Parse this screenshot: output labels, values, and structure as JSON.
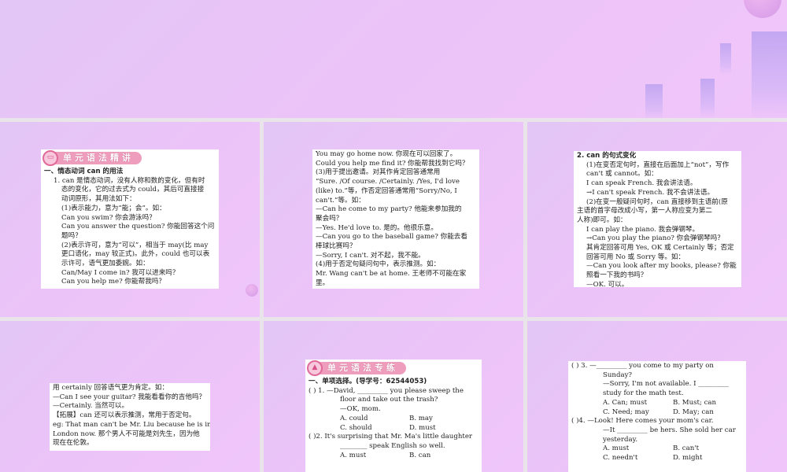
{
  "slides": [
    {
      "header": "单元语法精讲",
      "lines": [
        "一、情态动词 can 的用法",
        "1. can 是情态动词，没有人称和数的变化，但有时",
        "态的变化，它的过去式为 could，其后可直接接",
        "动词原形，其用法如下：",
        "(1)表示能力，意为“能；会”。如：",
        "Can you swim? 你会游泳吗？",
        "Can you answer the question? 你能回答这个问",
        "题吗？",
        "(2)表示许可，意为“可以”，相当于 may(比 may",
        "更口语化，may 较正式)。此外，could 也可以表",
        "示许可，语气更加委婉。如：",
        "Can/May I come in? 我可以进来吗？",
        "Can you help me? 你能帮我吗？"
      ]
    },
    {
      "lines": [
        "You may go home now. 你现在可以回家了。",
        "Could you help me find it? 你能帮我找到它吗？",
        "(3)用于提出邀请。对其作肯定回答通常用",
        "“Sure. /Of course. /Certainly. /Yes, I'd love",
        "(like) to.”等，作否定回答通常用“Sorry/No, I",
        "can't.”等。如：",
        "—Can he come to my party? 他能来参加我的",
        "聚会吗？",
        "—Yes. He'd love to. 是的。他很乐意。",
        "—Can you go to the baseball game? 你能去看",
        "棒球比赛吗？",
        "—Sorry, I can't. 对不起，我不能。",
        "(4)用于否定句疑问句中，表示推测。如：",
        "Mr. Wang can't be at home. 王老师不可能在家",
        "里。"
      ]
    },
    {
      "lines": [
        "2. can 的句式变化",
        "(1)在变否定句时，直接在后面加上“not”，写作",
        "can't 或 cannot。如：",
        "I can speak French. 我会讲法语。",
        "→I can't speak French. 我不会讲法语。",
        "(2)在变一般疑问句时，can 直接移到主语前(原",
        "主语的首字母改成小写，第一人称应变为第二",
        "人称)即可。如：",
        "I can play the piano. 我会弹钢琴。",
        "→Can you play the piano? 你会弹钢琴吗？",
        "其肯定回答可用 Yes, OK 或 Certainly 等；否定",
        "回答可用 No 或 Sorry 等。如：",
        "—Can you look after my books, please? 你能",
        "照看一下我的书吗？",
        "—OK. 可以。"
      ]
    },
    {
      "lines": [
        "用 certainly 回答语气更为肯定。如：",
        "—Can I see your guitar? 我能看看你的吉他吗？",
        "—Certainly. 当然可以。",
        "【拓展】can 还可以表示推测，常用于否定句。",
        "eg: That man can't be Mr. Liu because he is in",
        "London now. 那个男人不可能是刘先生，因为他",
        "现在在伦敦。"
      ]
    },
    {
      "header": "单元语法专练",
      "section": "一、单项选择。(导学号：62544053)",
      "q1": [
        "(      ) 1. —David, _________ you please sweep the",
        "floor and take out the trash?",
        "—OK, mom."
      ],
      "q1opts": [
        [
          "A. could",
          "B. may"
        ],
        [
          "C. should",
          "D. must"
        ]
      ],
      "q2": [
        "(      )2. It's surprising that Mr. Ma's little daughter",
        "________ speak English so well."
      ],
      "q2opts": [
        [
          "A. must",
          "B. can"
        ]
      ]
    },
    {
      "q3": [
        "(      ) 3. —_________ you come to my party on",
        "Sunday?",
        "—Sorry, I'm not available. I _________",
        "study for the math test."
      ],
      "q3opts": [
        [
          "A. Can; must",
          "B. Must; can"
        ],
        [
          "C. Need; may",
          "D. May; can"
        ]
      ],
      "q4": [
        "(      )4. —Look! Here comes your mom's car.",
        "—It _________ be hers. She sold her car",
        "yesterday."
      ],
      "q4opts": [
        [
          "A. must",
          "B. can't"
        ],
        [
          "C. needn't",
          "D. might"
        ]
      ]
    }
  ]
}
